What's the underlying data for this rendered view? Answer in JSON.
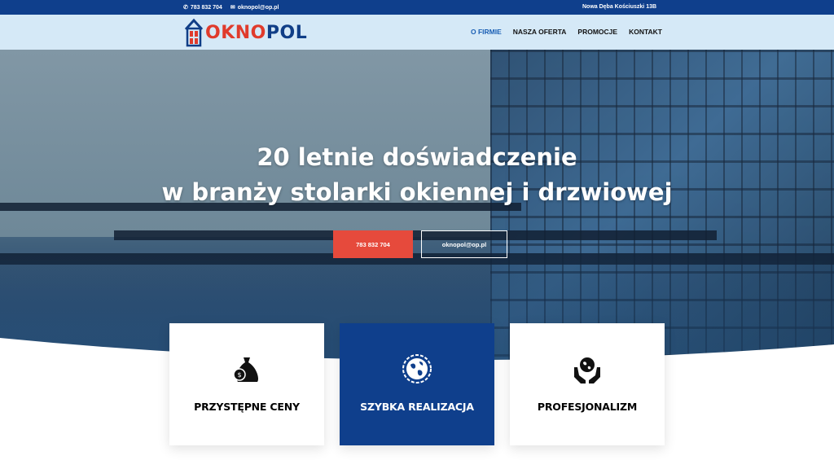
{
  "topbar": {
    "phone": "783 832 704",
    "email": "oknopol@op.pl",
    "address": "Nowa Dęba Kościuszki 13B"
  },
  "logo": {
    "part1": "OKNO",
    "part2": "POL"
  },
  "nav": {
    "items": [
      {
        "label": "O FIRMIE",
        "active": true
      },
      {
        "label": "NASZA OFERTA",
        "active": false
      },
      {
        "label": "PROMOCJE",
        "active": false
      },
      {
        "label": "KONTAKT",
        "active": false
      }
    ]
  },
  "hero": {
    "title_line1": "20 letnie doświadczenie",
    "title_line2": "w branży stolarki okiennej i drzwiowej",
    "phone_button": "783 832 704",
    "email_button": "oknopol@op.pl"
  },
  "features": [
    {
      "label": "PRZYSTĘPNE CENY",
      "icon": "money-bag-icon"
    },
    {
      "label": "SZYBKA REALIZACJA",
      "icon": "globe-icon"
    },
    {
      "label": "PROFESJONALIZM",
      "icon": "hands-globe-icon"
    }
  ],
  "colors": {
    "brand_blue": "#0f3f8c",
    "accent_red": "#e64a3c",
    "header_bg": "#d5e9f7"
  }
}
